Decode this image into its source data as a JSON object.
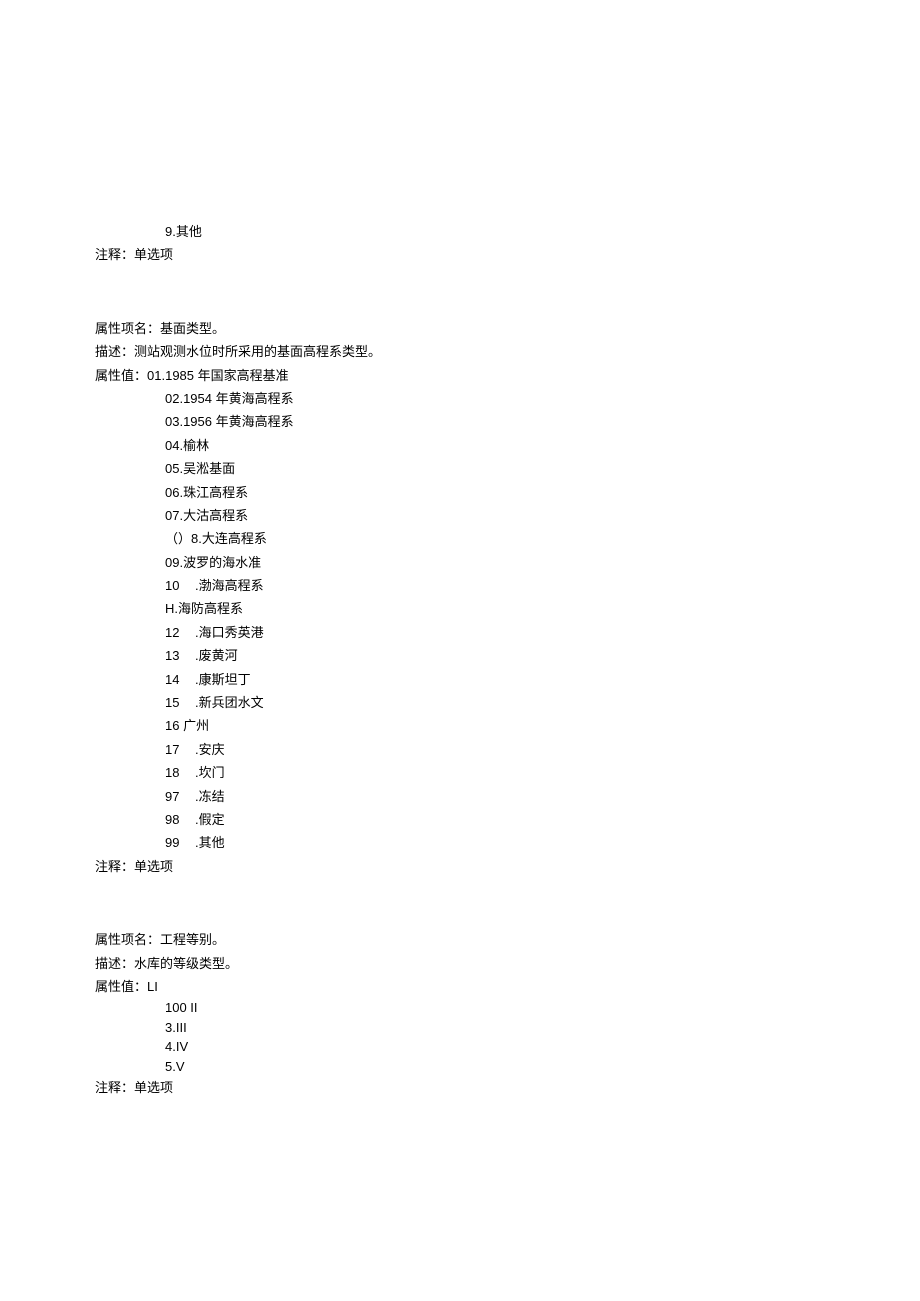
{
  "block1": {
    "value_item": "9.其他",
    "note_label": "注释：",
    "note_value": "单选项"
  },
  "block2": {
    "name_label": "属性项名：",
    "name_value": "基面类型。",
    "desc_label": "描述：",
    "desc_value": "测站观测水位时所采用的基面高程系类型。",
    "values_label": "属性值：",
    "values": [
      "01.1985 年国家高程基准",
      "02.1954 年黄海高程系",
      "03.1956 年黄海高程系",
      "04.榆林",
      "05.吴淞基面",
      "06.珠江高程系",
      "07.大沽高程系",
      "（）8.大连高程系",
      "09.波罗的海水准"
    ],
    "values_numbered": [
      {
        "num": "10",
        "text": ".渤海高程系"
      }
    ],
    "values_mid": [
      "H.海防高程系"
    ],
    "values_numbered2": [
      {
        "num": "12",
        "text": ".海口秀英港"
      },
      {
        "num": "13",
        "text": ".废黄河"
      },
      {
        "num": "14",
        "text": ".康斯坦丁"
      },
      {
        "num": "15",
        "text": ".新兵团水文"
      }
    ],
    "values_mid2": [
      "16 广州"
    ],
    "values_numbered3": [
      {
        "num": "17",
        "text": ".安庆"
      },
      {
        "num": "18",
        "text": ".坎门"
      },
      {
        "num": "97",
        "text": ".冻结"
      },
      {
        "num": "98",
        "text": ".假定"
      },
      {
        "num": "99",
        "text": ".其他"
      }
    ],
    "note_label": "注释：",
    "note_value": "单选项"
  },
  "block3": {
    "name_label": "属性项名：",
    "name_value": "工程等别。",
    "desc_label": "描述：",
    "desc_value": "水库的等级类型。",
    "values_label": "属性值：",
    "values_first": "LI",
    "values": [
      "100  II",
      "3.III",
      "4.IV",
      "5.V"
    ],
    "note_label": "注释：",
    "note_value": "单选项"
  }
}
